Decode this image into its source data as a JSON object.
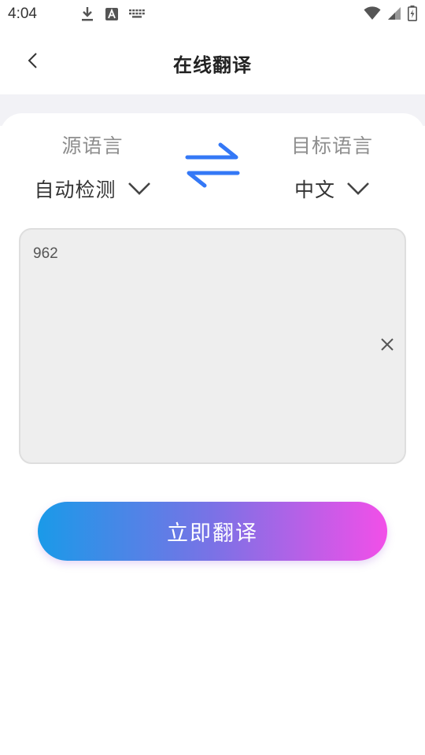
{
  "status_bar": {
    "time": "4:04",
    "icons": [
      "download-icon",
      "text-a-icon",
      "keyboard-icon",
      "wifi-icon",
      "cellular-signal-icon",
      "battery-charging-icon"
    ]
  },
  "header": {
    "title": "在线翻译",
    "back_icon": "chevron-left-icon"
  },
  "languages": {
    "source": {
      "caption": "源语言",
      "value": "自动检测"
    },
    "target": {
      "caption": "目标语言",
      "value": "中文"
    },
    "swap_icon": "swap-arrows-icon"
  },
  "input": {
    "value": "962",
    "clear_icon": "close-icon"
  },
  "actions": {
    "translate_label": "立即翻译"
  },
  "colors": {
    "accent_blue": "#3478f6",
    "gradient_start": "#1a9ae8",
    "gradient_end": "#f24fe8"
  }
}
